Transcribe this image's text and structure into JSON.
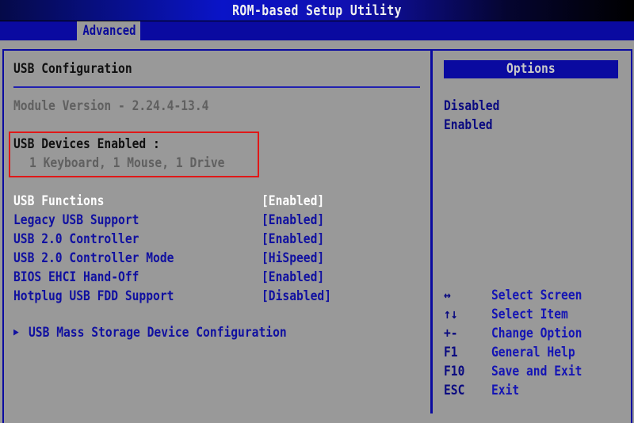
{
  "window": {
    "title": "ROM-based Setup Utility"
  },
  "tabs": [
    {
      "label": "Advanced",
      "active": true
    }
  ],
  "main": {
    "section_title": "USB Configuration",
    "module_version": "Module Version - 2.24.4-13.4",
    "devices": {
      "label": "USB Devices Enabled :",
      "value": "1 Keyboard, 1 Mouse, 1 Drive"
    },
    "settings": [
      {
        "name": "USB Functions",
        "value": "[Enabled]",
        "selected": true
      },
      {
        "name": "Legacy USB Support",
        "value": "[Enabled]",
        "selected": false
      },
      {
        "name": "USB 2.0 Controller",
        "value": "[Enabled]",
        "selected": false
      },
      {
        "name": "USB 2.0 Controller Mode",
        "value": "[HiSpeed]",
        "selected": false
      },
      {
        "name": "BIOS EHCI Hand-Off",
        "value": "[Enabled]",
        "selected": false
      },
      {
        "name": "Hotplug USB FDD Support",
        "value": "[Disabled]",
        "selected": false
      }
    ],
    "submenu": {
      "arrow_icon": "triangle-right-icon",
      "label": "USB Mass Storage Device Configuration"
    }
  },
  "options_panel": {
    "header": "Options",
    "options": [
      "Disabled",
      "Enabled"
    ],
    "help_keys": [
      {
        "key": "↔",
        "description": "Select Screen"
      },
      {
        "key": "↑↓",
        "description": "Select Item"
      },
      {
        "key": "+-",
        "description": "Change Option"
      },
      {
        "key": "F1",
        "description": "General Help"
      },
      {
        "key": "F10",
        "description": "Save and Exit"
      },
      {
        "key": "ESC",
        "description": "Exit"
      }
    ]
  },
  "colors": {
    "background": "#999999",
    "frame_blue": "#0a0aa0",
    "item_text": "#1010a0",
    "selected_text": "#ffffff",
    "highlight_box": "#e01818"
  }
}
